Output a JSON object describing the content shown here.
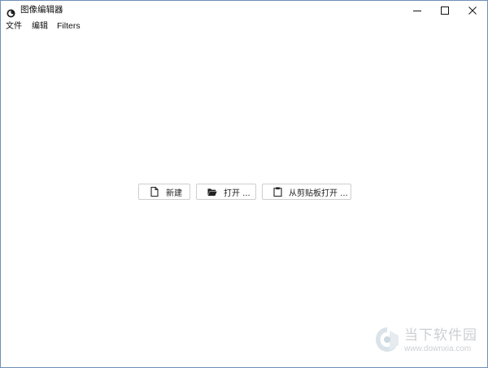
{
  "window": {
    "title": "图像编辑器",
    "controls": {
      "minimize": "minimize-icon",
      "maximize": "maximize-icon",
      "close": "close-icon"
    }
  },
  "menubar": {
    "items": [
      {
        "label": "文件"
      },
      {
        "label": "编辑"
      },
      {
        "label": "Filters"
      }
    ]
  },
  "actions": {
    "new": {
      "label": "新建",
      "icon": "file-icon"
    },
    "open": {
      "label": "打开 ...",
      "icon": "folder-open-icon"
    },
    "open_clipboard": {
      "label": "从剪贴板打开 ...",
      "icon": "clipboard-icon"
    }
  },
  "watermark": {
    "name": "当下软件园",
    "url": "www.downxia.com"
  },
  "colors": {
    "border": "#6f8fb5",
    "button_border": "#cfcfcf",
    "text": "#1a1a1a",
    "watermark": "#9aa0a6"
  }
}
